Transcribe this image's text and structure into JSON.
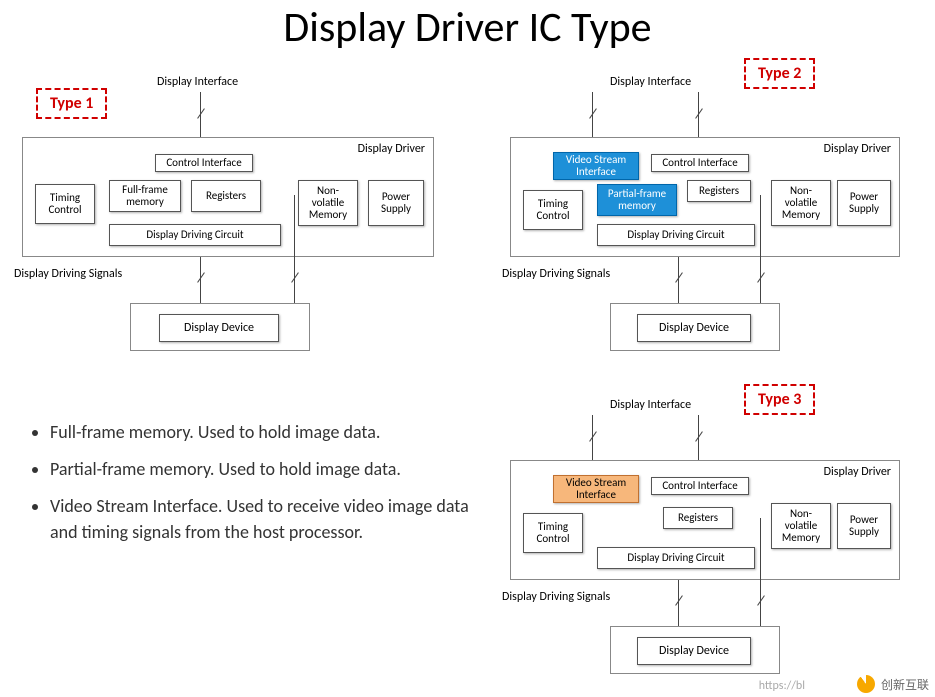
{
  "title": "Display Driver IC Type",
  "types": {
    "t1": "Type 1",
    "t2": "Type 2",
    "t3": "Type 3"
  },
  "labels": {
    "display_interface": "Display Interface",
    "display_driver": "Display Driver",
    "control_interface": "Control Interface",
    "video_stream_interface": "Video Stream Interface",
    "full_frame_memory": "Full-frame memory",
    "partial_frame_memory": "Partial-frame memory",
    "registers": "Registers",
    "timing_control": "Timing Control",
    "non_volatile_memory": "Non-volatile Memory",
    "power_supply": "Power Supply",
    "display_driving_circuit": "Display Driving Circuit",
    "display_driving_signals": "Display Driving Signals",
    "display_device": "Display Device"
  },
  "bullets": [
    "Full-frame memory. Used to hold image data.",
    "Partial-frame memory. Used to hold image data.",
    "Video Stream Interface. Used to receive video image data and timing signals from the host processor."
  ],
  "watermark": {
    "brand": "创新互联",
    "url": "https://bl"
  }
}
